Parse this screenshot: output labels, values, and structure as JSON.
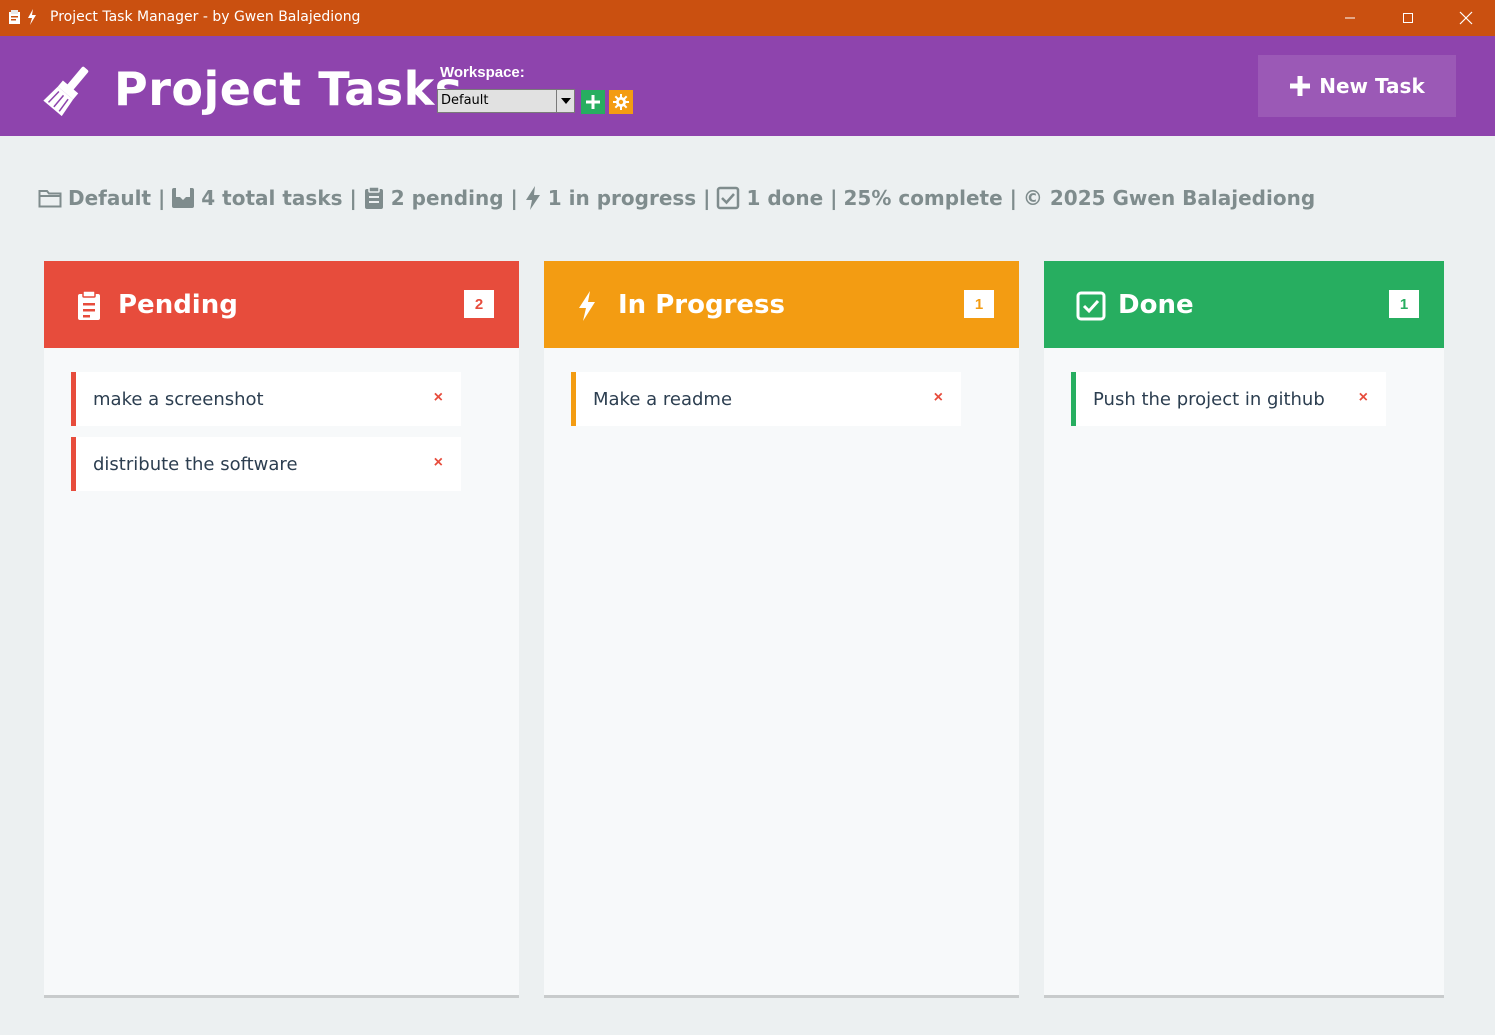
{
  "window": {
    "title": "Project Task Manager - by Gwen Balajediong",
    "controls": [
      "minimize-icon",
      "maximize-icon",
      "close-icon"
    ]
  },
  "header": {
    "app_title": "Project Tasks",
    "logo_icon": "broom-icon",
    "workspace_label": "Workspace:",
    "workspace_selected": "Default",
    "new_task_label": "New Task",
    "colors": {
      "header_bg": "#8e44ad",
      "new_task_bg": "#9b59b6",
      "add_ws": "#27ae60",
      "settings_ws": "#f39c12"
    }
  },
  "status": {
    "workspace": "Default |",
    "total": "4 total tasks |",
    "pending": "2 pending |",
    "in_progress": "1 in progress |",
    "done": "1 done |",
    "complete": "25% complete |",
    "copyright": "© 2025 Gwen Balajediong"
  },
  "columns": [
    {
      "title": "Pending",
      "count": "2",
      "color": "#e74c3c",
      "icon": "clipboard-icon",
      "tasks": [
        {
          "text": "make a screenshot",
          "delete": "×"
        },
        {
          "text": "distribute the software",
          "delete": "×"
        }
      ]
    },
    {
      "title": "In Progress",
      "count": "1",
      "color": "#f39c12",
      "icon": "lightning-icon",
      "tasks": [
        {
          "text": "Make a readme",
          "delete": "×"
        }
      ]
    },
    {
      "title": "Done",
      "count": "1",
      "color": "#27ae60",
      "icon": "checkbox-icon",
      "tasks": [
        {
          "text": "Push the project in github",
          "delete": "×"
        }
      ]
    }
  ]
}
